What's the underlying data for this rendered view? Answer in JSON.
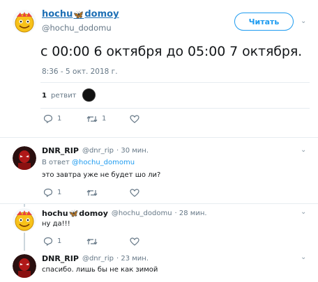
{
  "main_tweet": {
    "display_name": "hochu",
    "display_name_suffix": "domoy",
    "butterfly_icon": "🦋",
    "handle": "@hochu_dodomu",
    "follow_label": "Читать",
    "text": "с 00:00 6 октября до 05:00 7 октября.",
    "timestamp": "8:36 - 5 окт. 2018 г.",
    "retweets_count": "1",
    "retweets_label": "ретвит",
    "actions": {
      "reply_count": "1",
      "retweet_count": "1",
      "like_count": ""
    }
  },
  "replies": [
    {
      "name": "DNR_RIP",
      "handle": "@dnr_rip",
      "time": "· 30 мин.",
      "reply_to_label": "В ответ",
      "reply_to_handle": "@hochu_domomu",
      "text": "это завтра уже не будет шо ли?",
      "actions": {
        "reply_count": "1",
        "retweet_count": "",
        "like_count": ""
      }
    },
    {
      "name": "hochu",
      "name_suffix": "domoy",
      "handle": "@hochu_dodomu",
      "time": "· 28 мин.",
      "text": "ну да!!!",
      "actions": {
        "reply_count": "1",
        "retweet_count": "",
        "like_count": ""
      }
    },
    {
      "name": "DNR_RIP",
      "handle": "@dnr_rip",
      "time": "· 23 мин.",
      "text": "спасибо. лишь бы не как зимой"
    }
  ],
  "colors": {
    "link": "#1d9bf0",
    "name_blue": "#1d6fb5",
    "muted": "#657786",
    "border": "#e6ecf0"
  },
  "icons": [
    "reply-icon",
    "retweet-icon",
    "like-icon",
    "chevron-down-icon",
    "butterfly-icon"
  ]
}
